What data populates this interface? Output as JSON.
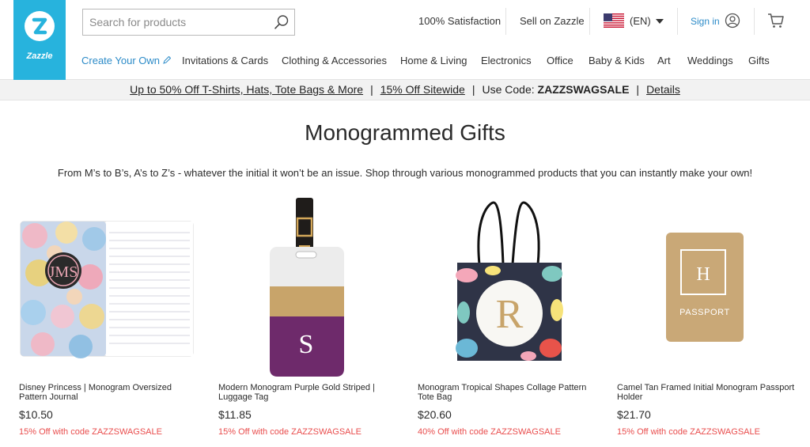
{
  "header": {
    "logo_text": "Zazzle",
    "search_placeholder": "Search for products",
    "satisfaction": "100% Satisfaction",
    "sell": "Sell on Zazzle",
    "lang": "(EN)",
    "signin": "Sign in",
    "icons": [
      "search-icon",
      "us-flag-icon",
      "chevron-down-icon",
      "user-icon",
      "cart-icon"
    ]
  },
  "nav": [
    "Create Your Own",
    "Invitations & Cards",
    "Clothing & Accessories",
    "Home & Living",
    "Electronics",
    "Office",
    "Baby & Kids",
    "Art",
    "Weddings",
    "Gifts"
  ],
  "promo": {
    "offer1": "Up to 50% Off T-Shirts, Hats, Tote Bags & More",
    "offer2": "15% Off Sitewide",
    "code_label": "Use Code:",
    "code": "ZAZZSWAGSALE",
    "details": "Details",
    "separator": "|"
  },
  "page": {
    "title": "Monogrammed Gifts",
    "subtitle": "From M’s to B’s, A’s to Z’s - whatever the initial it won’t be an issue. Shop through various monogrammed products that you can instantly make your own!"
  },
  "products": [
    {
      "name": "Disney Princess | Monogram Oversized Pattern Journal",
      "price": "$10.50",
      "promo": "15% Off with code ZAZZSWAGSALE",
      "monogram": "JMS"
    },
    {
      "name": "Modern Monogram Purple Gold Striped | Luggage Tag",
      "price": "$11.85",
      "promo": "15% Off with code ZAZZSWAGSALE",
      "monogram": "S"
    },
    {
      "name": "Monogram Tropical Shapes Collage Pattern Tote Bag",
      "price": "$20.60",
      "promo": "40% Off with code ZAZZSWAGSALE",
      "monogram": "R"
    },
    {
      "name": "Camel Tan Framed Initial Monogram Passport Holder",
      "price": "$21.70",
      "promo": "15% Off with code ZAZZSWAGSALE",
      "monogram": "H",
      "cover_text": "PASSPORT"
    }
  ],
  "colors": {
    "brand": "#27b3dd",
    "link": "#2c8bc8",
    "promo_red": "#e94d4d",
    "purple": "#6e2a6b",
    "gold": "#c8a46a",
    "camel": "#c9a877"
  }
}
